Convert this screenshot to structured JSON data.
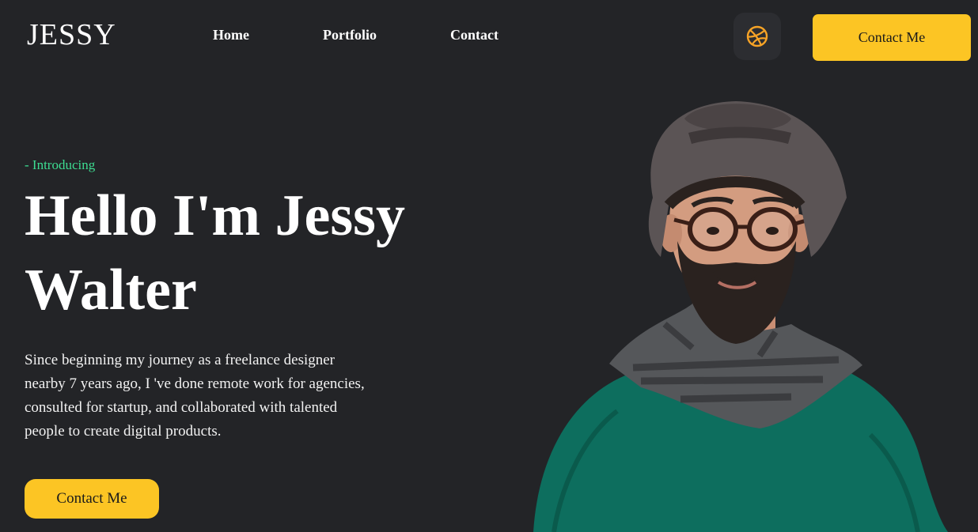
{
  "brand": {
    "logo": "JESSY"
  },
  "nav": {
    "items": [
      "Home",
      "Portfolio",
      "Contact"
    ]
  },
  "header": {
    "dribbble_icon": "dribbble-icon",
    "contact_label": "Contact Me"
  },
  "hero": {
    "eyebrow": "- Introducing",
    "headline_line1": "Hello I'm Jessy",
    "headline_line2": "Walter",
    "bio": "Since beginning my journey as a freelance designer nearby 7 years ago, I 've done remote work for agencies, consulted for startup, and collaborated with talented people to create digital products.",
    "cta_label": "Contact Me"
  },
  "colors": {
    "background": "#232427",
    "accent": "#fcc524",
    "eyebrow": "#3ddc91",
    "dribbble": "#f7a326"
  }
}
